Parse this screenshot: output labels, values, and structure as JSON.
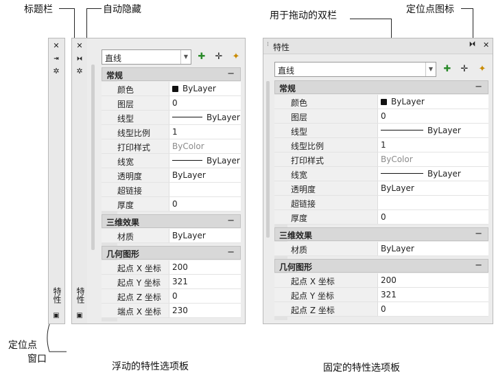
{
  "annotations": {
    "title_bar": "标题栏",
    "auto_hide": "自动隐藏",
    "drag_bar": "用于拖动的双栏",
    "anchor_icon": "定位点图标",
    "anchor_window_l1": "定位点",
    "anchor_window_l2": "窗口"
  },
  "captions": {
    "floating": "浮动的特性选项板",
    "docked": "固定的特性选项板"
  },
  "palette": {
    "title": "特性",
    "object_type": "直线",
    "sections": [
      {
        "title": "常规",
        "toggle": "−",
        "rows": [
          {
            "label": "颜色",
            "value": "ByLayer"
          },
          {
            "label": "图层",
            "value": "0"
          },
          {
            "label": "线型",
            "value": "ByLayer"
          },
          {
            "label": "线型比例",
            "value": "1"
          },
          {
            "label": "打印样式",
            "value": "ByColor"
          },
          {
            "label": "线宽",
            "value": "ByLayer"
          },
          {
            "label": "透明度",
            "value": "ByLayer"
          },
          {
            "label": "超链接",
            "value": ""
          },
          {
            "label": "厚度",
            "value": "0"
          }
        ]
      },
      {
        "title": "三维效果",
        "toggle": "−",
        "rows": [
          {
            "label": "材质",
            "value": "ByLayer"
          }
        ]
      },
      {
        "title": "几何图形",
        "toggle": "−",
        "rows": [
          {
            "label": "起点 X 坐标",
            "value": "200"
          },
          {
            "label": "起点 Y 坐标",
            "value": "321"
          },
          {
            "label": "起点 Z 坐标",
            "value": "0"
          },
          {
            "label": "端点 X 坐标",
            "value": "230"
          }
        ]
      }
    ]
  },
  "icons": {
    "close": "✕",
    "auto_hide": "⏵⏴",
    "settings": "✲",
    "dropdown": "▼",
    "quick_select": "✚",
    "pick": "✛",
    "toggle_pickadd": "✦"
  },
  "colors": {
    "swatch": "#111111",
    "section_bg": "#d8d8d8",
    "palette_bg": "#ececec"
  }
}
